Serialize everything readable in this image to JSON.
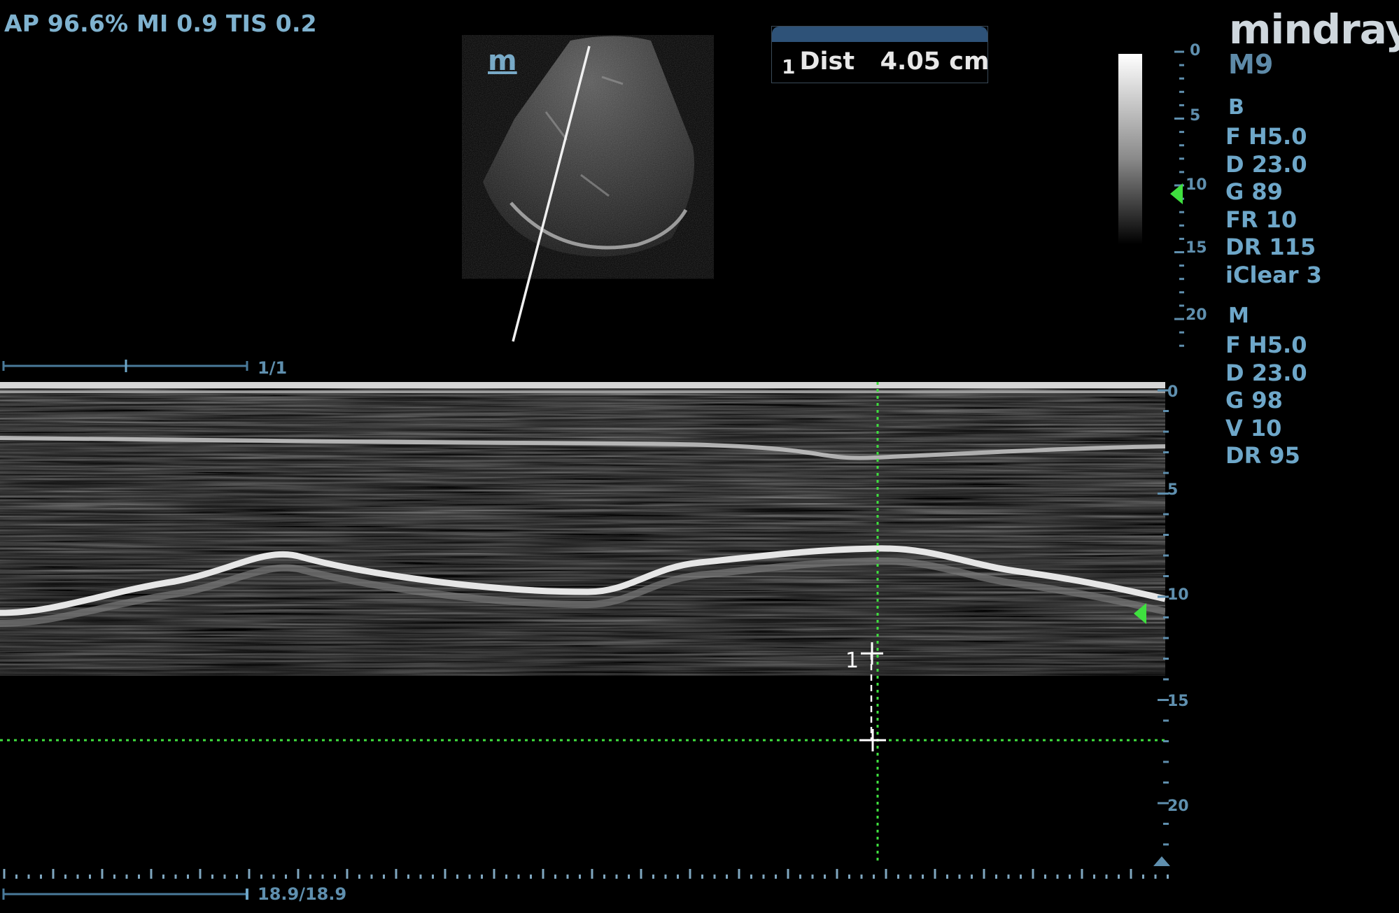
{
  "header": {
    "acoustic_output": "AP 96.6%  MI 0.9 TIS 0.2"
  },
  "brand": {
    "logo": "mindray",
    "model": "M9"
  },
  "mmode_icon": {
    "label": "m"
  },
  "measurement": {
    "index": "1",
    "label": "Dist",
    "value": "4.05 cm"
  },
  "b_mode_params": {
    "title": "B",
    "lines": [
      "F H5.0",
      "D 23.0",
      "G 89",
      "FR 10",
      "DR 115",
      "iClear 3"
    ]
  },
  "m_mode_params": {
    "title": "M",
    "lines": [
      "F H5.0",
      "D 23.0",
      "G 98",
      "V 10",
      "DR 95"
    ]
  },
  "b_depth_scale": {
    "labels": [
      "0",
      "5",
      "10",
      "15",
      "20"
    ]
  },
  "m_depth_scale": {
    "labels": [
      "0",
      "5",
      "10",
      "15",
      "20"
    ]
  },
  "cine": {
    "frame_counter": "1/1",
    "time_counter": "18.9/18.9"
  },
  "caliper": {
    "marker_label": "1"
  },
  "colors": {
    "accent_blue": "#6ea7c9",
    "marker_green": "#3fe03f",
    "measure_header": "#2e5278"
  }
}
